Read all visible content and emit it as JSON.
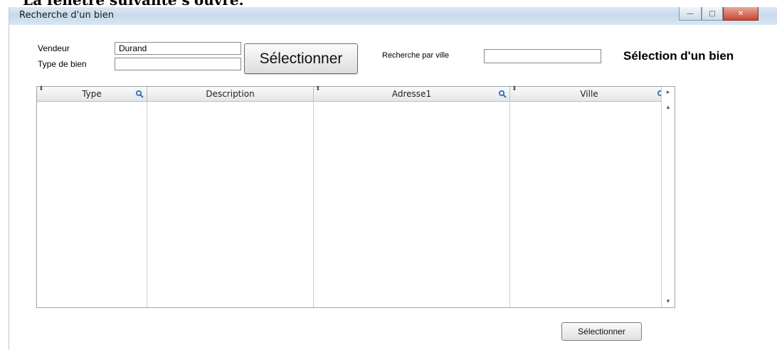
{
  "document": {
    "header_text": "La fenêtre suivante s'ouvre."
  },
  "window": {
    "title": "Recherche d'un bien",
    "controls": {
      "minimize": "—",
      "maximize": "□",
      "close": "✕"
    }
  },
  "form": {
    "vendeur_label": "Vendeur",
    "vendeur_value": "Durand",
    "type_label": "Type de bien",
    "type_value": "",
    "select_button_label": "Sélectionner",
    "ville_search_label": "Recherche par ville",
    "ville_search_value": "",
    "heading": "Sélection d'un bien"
  },
  "table": {
    "columns": [
      {
        "label": "Type",
        "sortable": true,
        "searchable": true
      },
      {
        "label": "Description",
        "sortable": false,
        "searchable": false
      },
      {
        "label": "Adresse1",
        "sortable": true,
        "searchable": true
      },
      {
        "label": "Ville",
        "sortable": true,
        "searchable": true
      }
    ],
    "rows": []
  },
  "footer": {
    "select_button_label": "Sélectionner"
  },
  "icons": {
    "search": "search-icon",
    "sort": "sort-icon"
  }
}
